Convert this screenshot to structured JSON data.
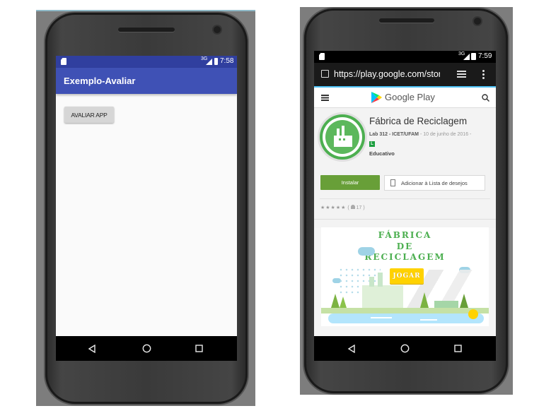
{
  "left_phone": {
    "status_bar": {
      "signal": "3G",
      "time": "7:58"
    },
    "app_bar": {
      "title": "Exemplo-Avaliar",
      "color": "#3f51b5"
    },
    "button": {
      "label": "AVALIAR APP"
    }
  },
  "right_phone": {
    "status_bar": {
      "signal": "3G",
      "time": "7:59"
    },
    "browser": {
      "url": "https://play.google.com/stor"
    },
    "play_header": {
      "brand": "Google Play"
    },
    "app": {
      "name": "Fábrica de Reciclagem",
      "developer": "Lab 312 - ICET/UFAM",
      "date": "- 10 de junho de 2016 -",
      "rating_badge": "L",
      "category": "Educativo",
      "install_label": "Instalar",
      "wishlist_label": "Adicionar à Lista de desejos",
      "stars": "★★★★★",
      "reviews": "17"
    },
    "banner": {
      "line1": "FÁBRICA",
      "line2": "DE",
      "line3": "RECICLAGEM",
      "play_label": "JOGAR"
    },
    "colors": {
      "install": "#689f38",
      "banner_title": "#4caf50"
    }
  }
}
